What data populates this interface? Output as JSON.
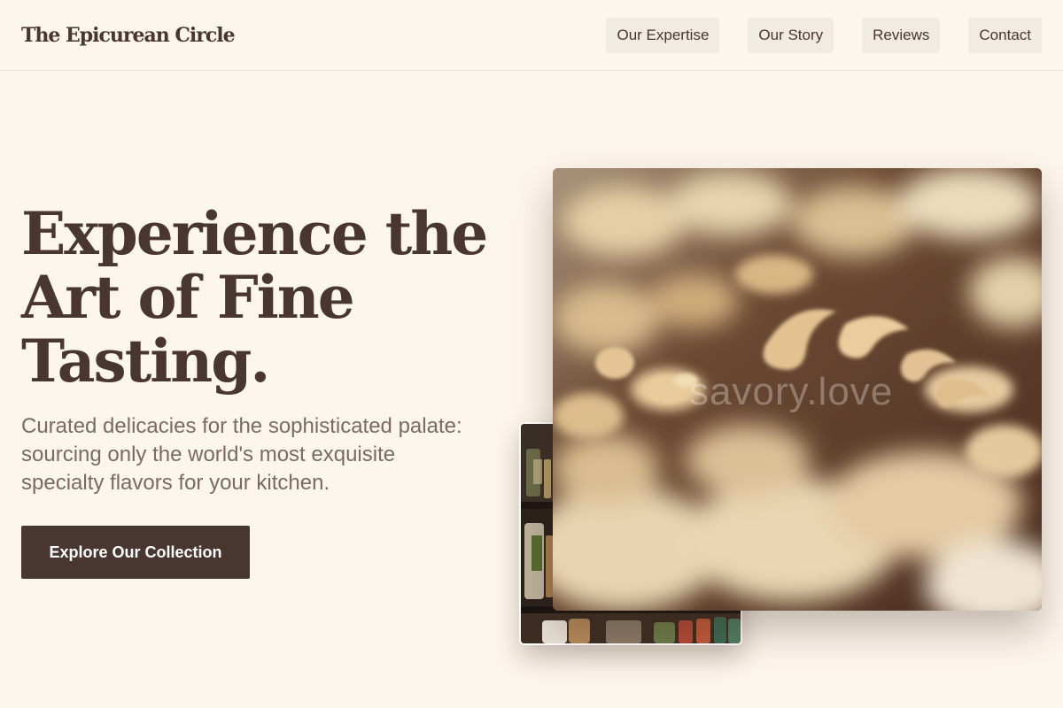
{
  "header": {
    "brand": "The Epicurean Circle",
    "nav": [
      {
        "label": "Our Expertise"
      },
      {
        "label": "Our Story"
      },
      {
        "label": "Reviews"
      },
      {
        "label": "Contact"
      }
    ]
  },
  "hero": {
    "title": "Experience the Art of Fine Tasting.",
    "subtitle": "Curated delicacies for the sophisticated palate: sourcing only the world's most exquisite specialty flavors for your kitchen.",
    "cta_label": "Explore Our Collection",
    "watermark": "savory.love"
  },
  "colors": {
    "background": "#fdf6ec",
    "primary": "#4a3630",
    "nav_button": "#f1ebe3",
    "muted_text": "#7a6a64"
  }
}
